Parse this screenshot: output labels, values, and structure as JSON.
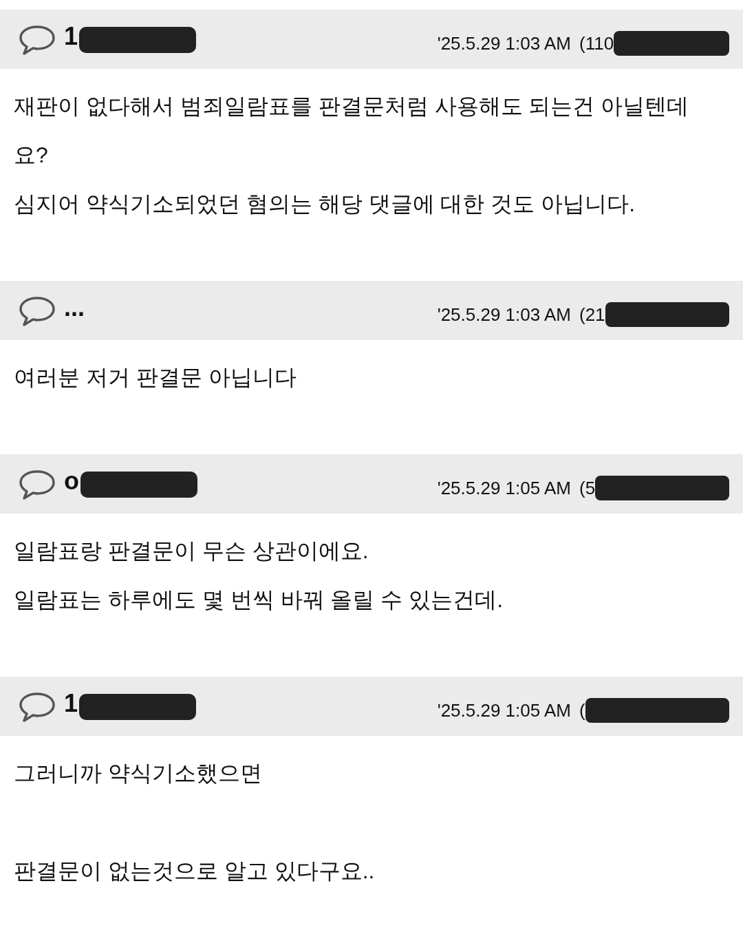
{
  "comments": [
    {
      "author": "1",
      "author_redacted": true,
      "date": "'25.5.29 1:03 AM",
      "ip": "(110",
      "ip_redacted": true,
      "paragraphs": [
        [
          "재판이 없다해서 범죄일람표를 판결문처럼 사용해도 되는건 아닐텐데요?",
          "심지어 약식기소되었던 혐의는 해당 댓글에 대한 것도 아닙니다."
        ]
      ]
    },
    {
      "author": "...",
      "date": "'25.5.29 1:03 AM",
      "ip": "(21",
      "ip_redacted": true,
      "paragraphs": [
        [
          "여러분 저거 판결문 아닙니다"
        ]
      ]
    },
    {
      "author": "o",
      "author_redacted": true,
      "date": "'25.5.29 1:05 AM",
      "ip": "(5",
      "ip_redacted": true,
      "paragraphs": [
        [
          "일람표랑 판결문이 무슨 상관이에요.",
          "일람표는 하루에도 몇 번씩 바꿔 올릴 수 있는건데."
        ]
      ]
    },
    {
      "author": "1",
      "author_redacted": true,
      "date": "'25.5.29 1:05 AM",
      "ip": "(",
      "ip_redacted": true,
      "paragraphs": [
        [
          "그러니까 약식기소했으면"
        ],
        [
          "판결문이 없는것으로 알고 있다구요.."
        ]
      ]
    }
  ]
}
